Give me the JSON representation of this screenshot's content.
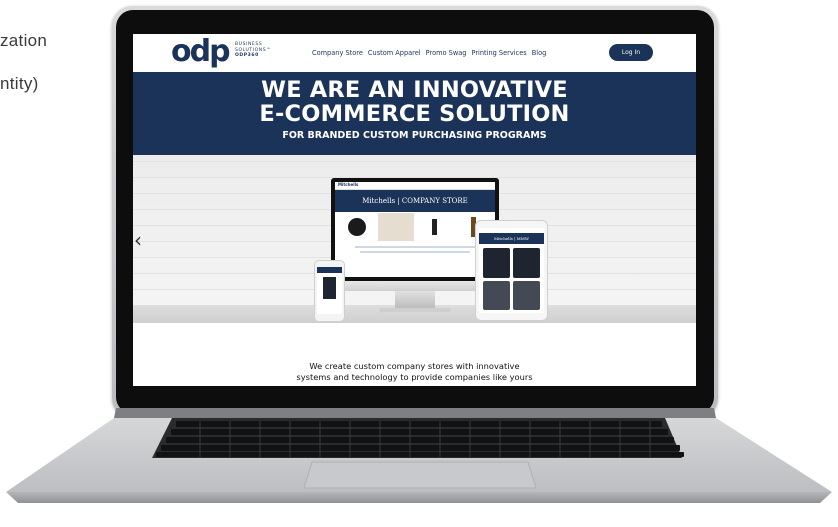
{
  "background": {
    "line1": "zation",
    "line2": "ntity)"
  },
  "site": {
    "logo": {
      "mark": "odp",
      "sub1": "BUSINESS",
      "sub2": "SOLUTIONS™",
      "sub3": "ODP360"
    },
    "nav": [
      "Company Store",
      "Custom Apparel",
      "Promo Swag",
      "Printing Services",
      "Blog"
    ],
    "login_label": "Log In",
    "hero": {
      "line1": "WE ARE AN INNOVATIVE",
      "line2": "E-COMMERCE SOLUTION",
      "line3": "FOR BRANDED CUSTOM PURCHASING PROGRAMS"
    },
    "slider": {
      "prev_arrow": "‹",
      "monitor_brand": "Mitchells",
      "monitor_banner": "Mitchells | COMPANY STORE",
      "tablet_banner": "Mitchells | MMW"
    },
    "intro": {
      "line1": "We create custom company stores with innovative",
      "line2": "systems and technology to provide companies like yours"
    }
  },
  "colors": {
    "brand_navy": "#1b3359",
    "laptop_silver": "#c8c9cb"
  }
}
